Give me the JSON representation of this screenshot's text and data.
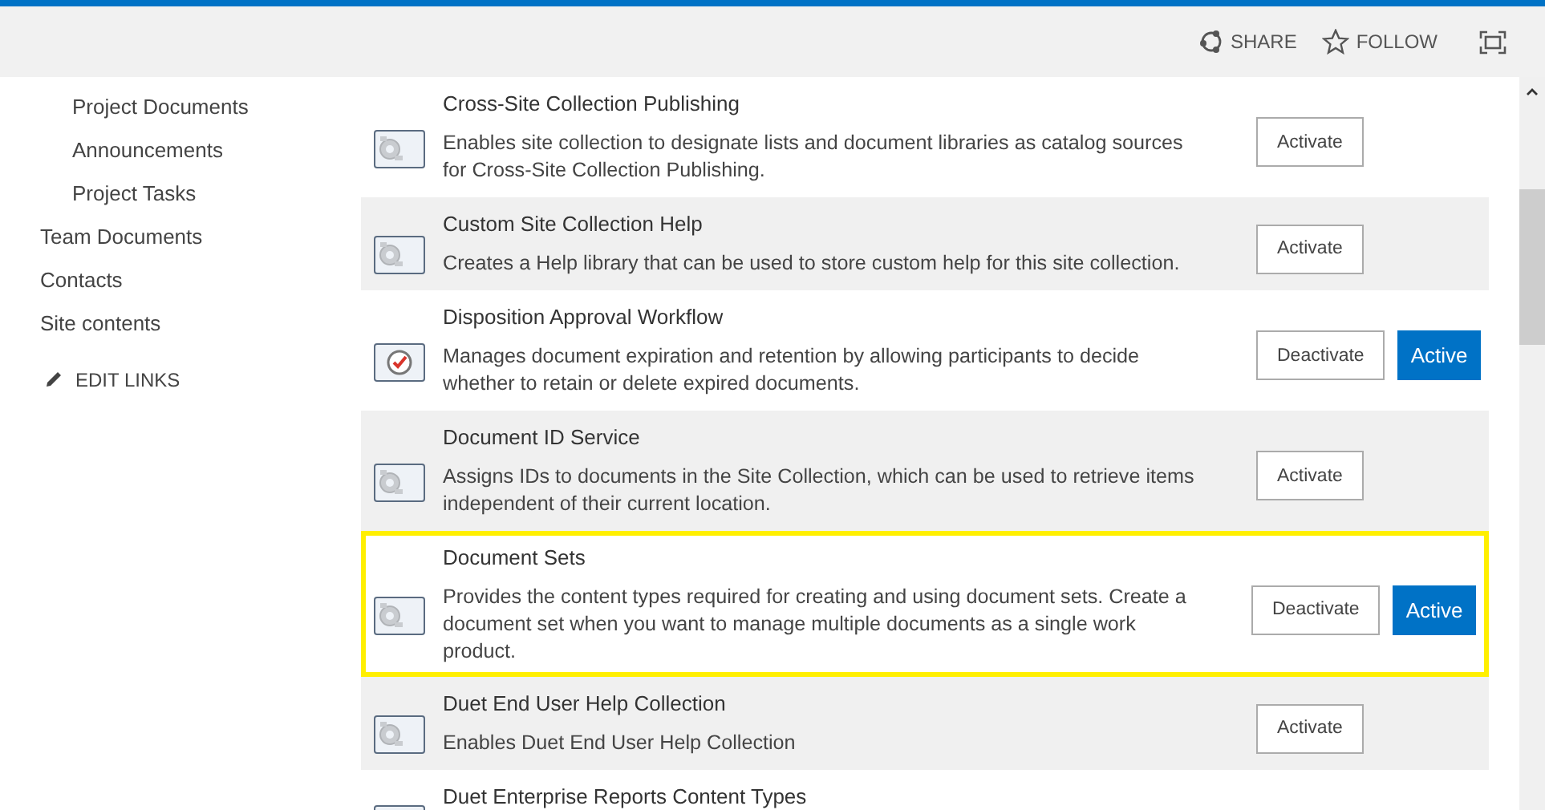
{
  "header": {
    "actions": [
      {
        "kind": "share",
        "label": "SHARE"
      },
      {
        "kind": "follow",
        "label": "FOLLOW"
      },
      {
        "kind": "focus"
      }
    ]
  },
  "nav": {
    "items": [
      "Project Documents",
      "Announcements",
      "Project Tasks"
    ],
    "top_items": [
      "Team Documents",
      "Contacts",
      "Site contents"
    ],
    "edit_links": "EDIT LINKS"
  },
  "features": [
    {
      "kind": "feature",
      "title": "Cross-Site Collection Publishing",
      "description": "Enables site collection to designate lists and document libraries as catalog sources for Cross-Site Collection Publishing.",
      "action": "Activate",
      "highlighted": false
    },
    {
      "kind": "feature",
      "title": "Custom Site Collection Help",
      "description": "Creates a Help library that can be used to store custom help for this site collection.",
      "action": "Activate",
      "highlighted": false
    },
    {
      "kind": "workflow",
      "title": "Disposition Approval Workflow",
      "description": "Manages document expiration and retention by allowing participants to decide whether to retain or delete expired documents.",
      "action": "Deactivate",
      "status": "Active",
      "highlighted": false
    },
    {
      "kind": "feature",
      "title": "Document ID Service",
      "description": "Assigns IDs to documents in the Site Collection, which can be used to retrieve items independent of their current location.",
      "action": "Activate",
      "highlighted": false
    },
    {
      "kind": "feature",
      "title": "Document Sets",
      "description": "Provides the content types required for creating and using document sets. Create a document set when you want to manage multiple documents as a single work product.",
      "action": "Deactivate",
      "status": "Active",
      "highlighted": true
    },
    {
      "kind": "feature",
      "title": "Duet End User Help Collection",
      "description": "Enables Duet End User Help Collection",
      "action": "Activate",
      "highlighted": false
    },
    {
      "kind": "feature",
      "title": "Duet Enterprise Reports Content Types",
      "highlighted": false
    }
  ]
}
